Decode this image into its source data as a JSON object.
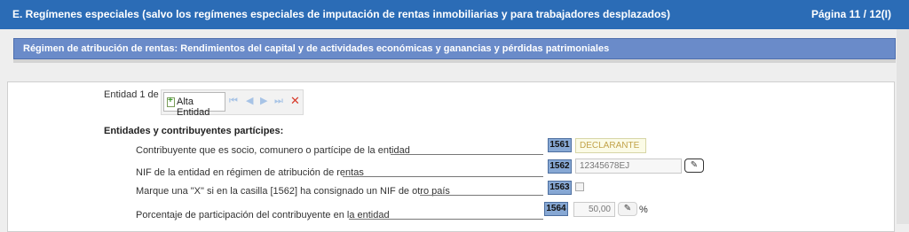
{
  "header": {
    "title": "E.  Regímenes especiales (salvo los regímenes especiales de imputación de rentas inmobiliarias y para trabajadores desplazados)",
    "page": "Página 11 / 12(I)",
    "color": "#2b6cb6"
  },
  "section": {
    "title": "Régimen de atribución de rentas: Rendimientos del capital y de actividades económicas y ganancias y pérdidas patrimoniales"
  },
  "entity": {
    "counter": "Entidad 1 de 1",
    "add_button": "Alta Entidad",
    "nav_icons": [
      "first-icon",
      "previous-icon",
      "next-icon",
      "last-icon"
    ],
    "delete_icon": "delete-icon"
  },
  "participants": {
    "heading": "Entidades y contribuyentes partícipes:",
    "rows": [
      {
        "label": "Contribuyente que es socio, comunero o partícipe de la entidad",
        "box": "1561",
        "value": "DECLARANTE"
      },
      {
        "label": "NIF de la entidad en régimen de atribución de rentas",
        "box": "1562",
        "value": "12345678EJ"
      },
      {
        "label": "Marque una \"X\" si en la casilla [1562] ha consignado un NIF de otro país",
        "box": "1563",
        "checked": false
      },
      {
        "label": "Porcentaje de participación del contribuyente en la entidad",
        "box": "1564",
        "value": "50,00",
        "unit": "%"
      }
    ]
  }
}
